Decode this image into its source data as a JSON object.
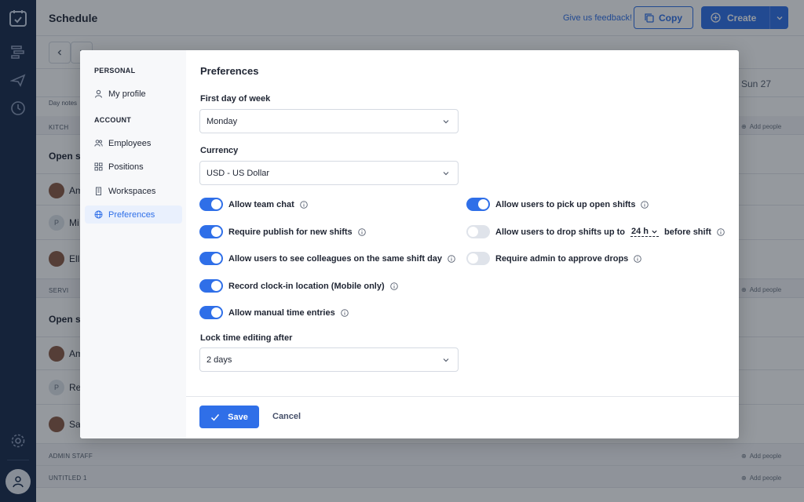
{
  "app": {
    "title": "Schedule",
    "feedback_link": "Give us feedback!",
    "copy_label": "Copy",
    "create_label": "Create",
    "accent_color": "#2f6fe8"
  },
  "schedule_bg": {
    "sun_label": "Sun 27",
    "day_notes": "Day notes",
    "groups": [
      "KITCH",
      "SERVI",
      "ADMIN STAFF",
      "UNTITLED 1"
    ],
    "open_shifts": [
      "Open sh",
      "Open sh"
    ],
    "people": [
      "Am",
      "Mi",
      "Ella",
      "Am",
      "Re",
      "Sa"
    ],
    "add_people": "Add people"
  },
  "modal_sidebar": {
    "personal_label": "PERSONAL",
    "my_profile": "My profile",
    "account_label": "ACCOUNT",
    "employees": "Employees",
    "positions": "Positions",
    "workspaces": "Workspaces",
    "preferences": "Preferences"
  },
  "preferences": {
    "heading": "Preferences",
    "first_day_label": "First day of week",
    "first_day_value": "Monday",
    "currency_label": "Currency",
    "currency_value": "USD - US Dollar",
    "lock_label": "Lock time editing after",
    "lock_value": "2 days",
    "toggles_left": [
      {
        "label": "Allow team chat",
        "on": true
      },
      {
        "label": "Require publish for new shifts",
        "on": true
      },
      {
        "label": "Allow users to see colleagues on the same shift day",
        "on": true
      },
      {
        "label": "Record clock-in location (Mobile only)",
        "on": true
      },
      {
        "label": "Allow manual time entries",
        "on": true
      }
    ],
    "toggle_pickup": {
      "label": "Allow users to pick up open shifts",
      "on": true
    },
    "toggle_drop": {
      "label_before": "Allow users to drop shifts up to",
      "hours": "24 h",
      "label_after": "before shift",
      "on": false
    },
    "toggle_approve": {
      "label": "Require admin to approve drops",
      "on": false
    },
    "save_label": "Save",
    "cancel_label": "Cancel"
  }
}
